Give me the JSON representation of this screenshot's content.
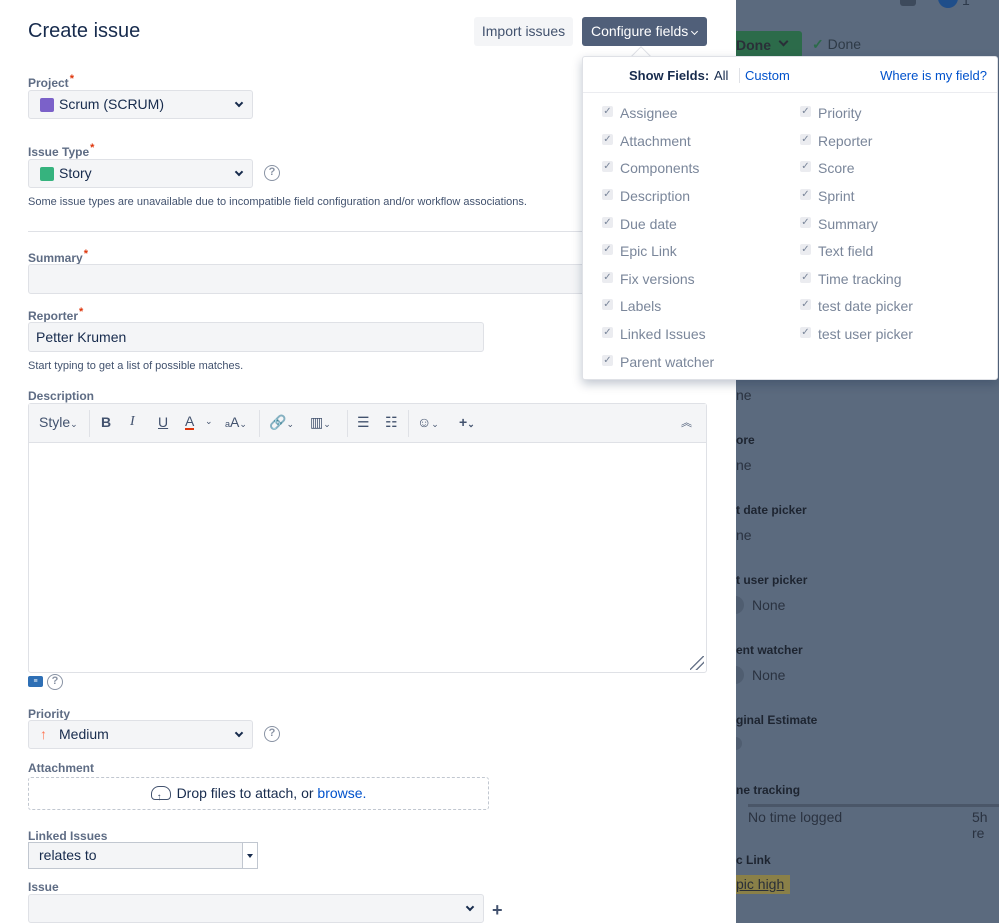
{
  "modal": {
    "title": "Create issue",
    "import_label": "Import issues",
    "configure_label": "Configure fields"
  },
  "form": {
    "project": {
      "label": "Project",
      "value": "Scrum (SCRUM)"
    },
    "issue_type": {
      "label": "Issue Type",
      "value": "Story",
      "hint": "Some issue types are unavailable due to incompatible field configuration and/or workflow associations."
    },
    "summary": {
      "label": "Summary",
      "value": ""
    },
    "reporter": {
      "label": "Reporter",
      "value": "Petter Krumen",
      "hint": "Start typing to get a list of possible matches."
    },
    "description": {
      "label": "Description",
      "style_label": "Style"
    },
    "priority": {
      "label": "Priority",
      "value": "Medium"
    },
    "attachment": {
      "label": "Attachment",
      "text": "Drop files to attach, or",
      "link": "browse."
    },
    "linked_issues": {
      "label": "Linked Issues",
      "value": "relates to"
    },
    "issue": {
      "label": "Issue",
      "value": ""
    }
  },
  "popup": {
    "show_fields_label": "Show Fields:",
    "all": "All",
    "custom": "Custom",
    "where": "Where is my field?",
    "left_fields": [
      "Assignee",
      "Attachment",
      "Components",
      "Description",
      "Due date",
      "Epic Link",
      "Fix versions",
      "Labels",
      "Linked Issues",
      "Parent watcher"
    ],
    "right_fields": [
      "Priority",
      "Reporter",
      "Score",
      "Sprint",
      "Summary",
      "Text field",
      "Time tracking",
      "test date picker",
      "test user picker"
    ]
  },
  "background": {
    "done_button": "Done",
    "done_status": "Done",
    "badge_count": "1",
    "fields": [
      {
        "label": "",
        "value": "ne"
      },
      {
        "label": "ore",
        "value": "ne"
      },
      {
        "label": "t date picker",
        "value": "ne"
      },
      {
        "label": "t user picker",
        "value": "None"
      },
      {
        "label": "ent watcher",
        "value": "None"
      },
      {
        "label": "ginal Estimate",
        "value": ""
      },
      {
        "label": "ne tracking",
        "value": "No time logged",
        "extra": "5h re"
      },
      {
        "label": "c Link",
        "value": "pic high"
      }
    ]
  },
  "colors": {
    "primary_button": "#505f79",
    "link": "#0052cc",
    "required": "#de350b",
    "overlay": "#5b6a7e"
  }
}
